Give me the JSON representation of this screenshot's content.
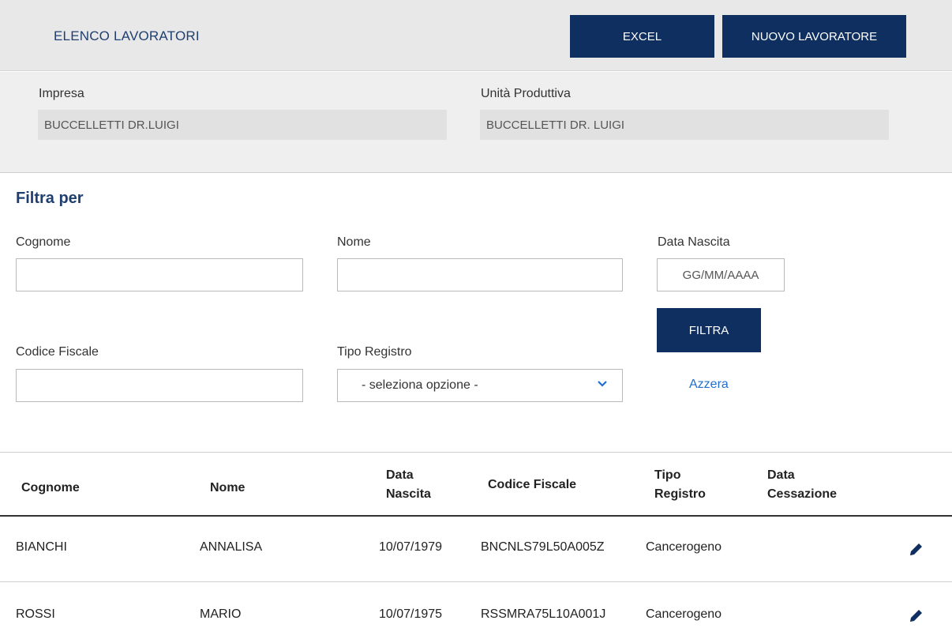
{
  "header": {
    "title": "ELENCO LAVORATORI",
    "excel_label": "EXCEL",
    "new_worker_label": "NUOVO LAVORATORE"
  },
  "company": {
    "impresa_label": "Impresa",
    "impresa_value": "BUCCELLETTI DR.LUIGI",
    "unita_label": "Unità Produttiva",
    "unita_value": "BUCCELLETTI DR. LUIGI"
  },
  "filter": {
    "title": "Filtra per",
    "cognome_label": "Cognome",
    "cognome_value": "",
    "nome_label": "Nome",
    "nome_value": "",
    "data_nascita_label": "Data Nascita",
    "data_nascita_placeholder": "GG/MM/AAAA",
    "codice_fiscale_label": "Codice Fiscale",
    "codice_fiscale_value": "",
    "tipo_registro_label": "Tipo Registro",
    "tipo_registro_selected": "- seleziona opzione -",
    "filtra_label": "FILTRA",
    "azzera_label": "Azzera"
  },
  "table": {
    "headers": {
      "cognome": "Cognome",
      "nome": "Nome",
      "data_nascita_1": "Data",
      "data_nascita_2": "Nascita",
      "codice_fiscale": "Codice Fiscale",
      "tipo_registro_1": "Tipo",
      "tipo_registro_2": "Registro",
      "data_cessazione_1": "Data",
      "data_cessazione_2": "Cessazione"
    },
    "rows": [
      {
        "cognome": "BIANCHI",
        "nome": "ANNALISA",
        "data_nascita": "10/07/1979",
        "codice_fiscale": "BNCNLS79L50A005Z",
        "tipo_registro": "Cancerogeno",
        "data_cessazione": ""
      },
      {
        "cognome": "ROSSI",
        "nome": "MARIO",
        "data_nascita": "10/07/1975",
        "codice_fiscale": "RSSMRA75L10A001J",
        "tipo_registro": "Cancerogeno",
        "data_cessazione": ""
      }
    ]
  },
  "icons": {
    "edit": "pencil-icon",
    "dropdown": "chevron-down-icon"
  },
  "colors": {
    "primary": "#0e2f5f",
    "title": "#1f3f70",
    "link": "#1f6fd0"
  }
}
